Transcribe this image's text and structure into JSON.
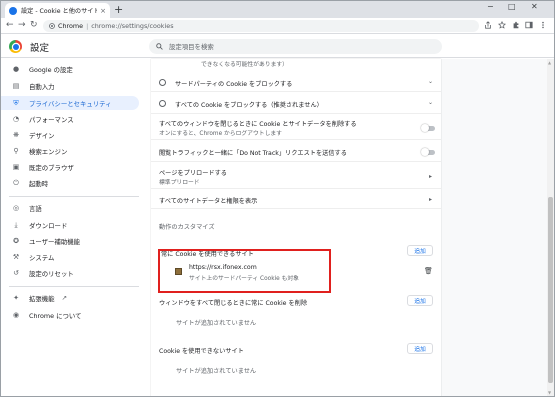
{
  "browser": {
    "tab_title": "設定 - Cookie と他のサイトデータ",
    "tab_close": "×",
    "new_tab": "+",
    "win_minimize": "−",
    "win_maximize": "□",
    "win_close": "✕",
    "back": "←",
    "forward": "→",
    "reload": "↻",
    "url_chip": "Chrome",
    "url_separator": "|",
    "url": "chrome://settings/cookies",
    "toolbar_icons": [
      "share-icon",
      "star-icon",
      "extensions-icon",
      "sidepanel-icon",
      "profile-icon",
      "menu-icon"
    ]
  },
  "header": {
    "title": "設定",
    "search_placeholder": "設定項目を検索"
  },
  "sidebar": {
    "items": [
      {
        "label": "Google の設定",
        "icon": "person-icon"
      },
      {
        "label": "自動入力",
        "icon": "clipboard-icon"
      },
      {
        "label": "プライバシーとセキュリティ",
        "icon": "shield-icon",
        "active": true
      },
      {
        "label": "パフォーマンス",
        "icon": "speedometer-icon"
      },
      {
        "label": "デザイン",
        "icon": "palette-icon"
      },
      {
        "label": "検索エンジン",
        "icon": "search-icon"
      },
      {
        "label": "既定のブラウザ",
        "icon": "browser-icon"
      },
      {
        "label": "起動時",
        "icon": "power-icon"
      },
      {
        "label": "言語",
        "icon": "globe-icon"
      },
      {
        "label": "ダウンロード",
        "icon": "download-icon"
      },
      {
        "label": "ユーザー補助機能",
        "icon": "accessibility-icon"
      },
      {
        "label": "システム",
        "icon": "wrench-icon"
      },
      {
        "label": "設定のリセット",
        "icon": "reset-icon"
      },
      {
        "label": "拡張機能",
        "icon": "puzzle-icon"
      },
      {
        "label": "Chrome について",
        "icon": "chrome-icon"
      }
    ],
    "external_link_icon": "↗"
  },
  "main": {
    "top_subtext": "できなくなる可能性があります）",
    "block_third_party": "サードパーティの Cookie をブロックする",
    "block_all": "すべての Cookie をブロックする（推奨されません）",
    "clear_on_close_line1": "すべてのウィンドウを閉じるときに Cookie とサイトデータを削除する",
    "clear_on_close_line2": "オンにすると、Chrome からログアウトします",
    "do_not_track": "閲覧トラフィックと一緒に「Do Not Track」リクエストを送信する",
    "preload_title": "ページをプリロードする",
    "preload_sub": "標準プリロード",
    "see_all_data": "すべてのサイトデータと権限を表示",
    "custom_behaviors": "動作のカスタマイズ",
    "allowed_section": "常に Cookie を使用できるサイト",
    "add_label": "追加",
    "allowed_site_url": "https://rsx.ifonex.com",
    "allowed_site_sub": "サイト上のサードパーティ Cookie も対象",
    "clear_on_exit_section": "ウィンドウをすべて閉じるときに常に Cookie を削除",
    "no_sites": "サイトが追加されていません",
    "blocked_section": "Cookie を使用できないサイト"
  },
  "colors": {
    "accent": "#1a73e8",
    "highlight_border": "#e0201e",
    "active_nav_bg": "#e8f0fe"
  }
}
